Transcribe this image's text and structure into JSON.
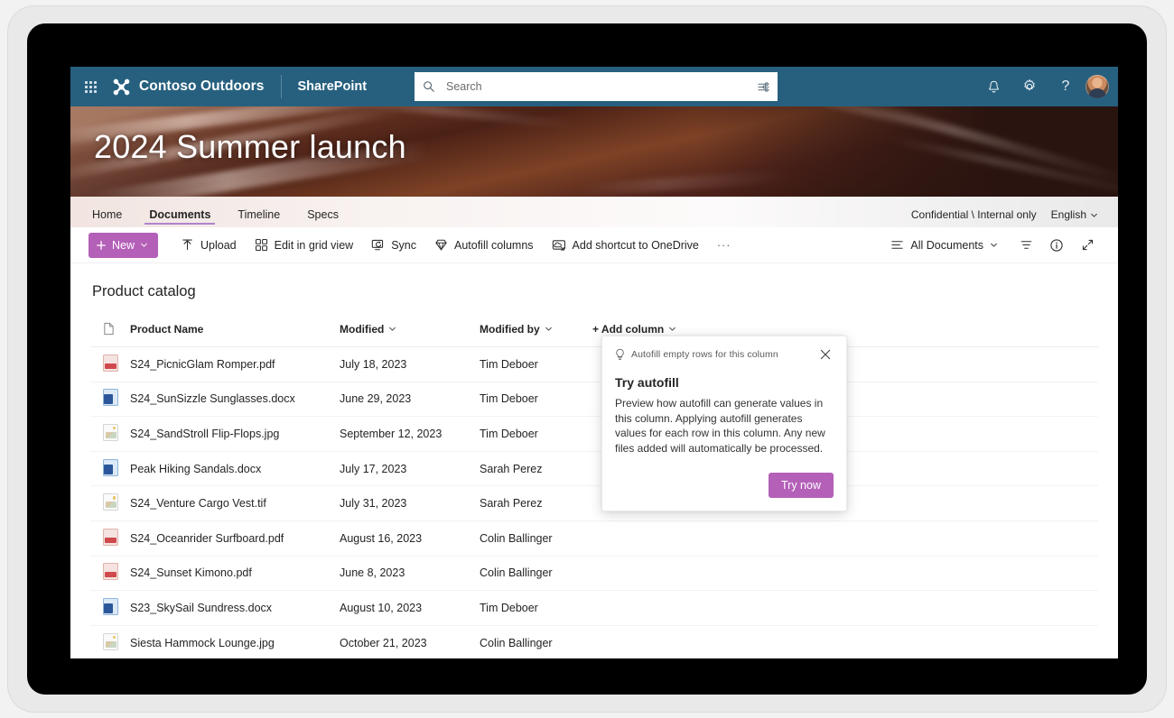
{
  "suite_header": {
    "waffle_label": "app-launcher",
    "brand_name": "Contoso Outdoors",
    "app_name": "SharePoint",
    "search_placeholder": "Search",
    "search_value": "",
    "icons": [
      "notifications-bell-icon",
      "settings-gear-icon",
      "help-question-icon",
      "user-avatar"
    ]
  },
  "hero": {
    "title": "2024 Summer launch"
  },
  "site_nav": {
    "items": [
      {
        "label": "Home",
        "active": false
      },
      {
        "label": "Documents",
        "active": true
      },
      {
        "label": "Timeline",
        "active": false
      },
      {
        "label": "Specs",
        "active": false
      }
    ],
    "sensitivity_label": "Confidential \\ Internal only",
    "language": "English"
  },
  "command_bar": {
    "new_label": "New",
    "commands": [
      {
        "label": "Upload",
        "icon": "upload-arrow-icon"
      },
      {
        "label": "Edit in grid view",
        "icon": "grid-view-icon"
      },
      {
        "label": "Sync",
        "icon": "sync-icon"
      },
      {
        "label": "Autofill columns",
        "icon": "autofill-diamond-icon"
      },
      {
        "label": "Add shortcut to OneDrive",
        "icon": "onedrive-shortcut-icon"
      }
    ],
    "overflow_label": "···",
    "view_label": "All Documents",
    "right_icons": [
      "filter-icon",
      "info-icon",
      "expand-icon"
    ]
  },
  "list": {
    "title": "Product catalog",
    "columns": [
      {
        "label": "",
        "icon": "document-type-icon",
        "sortable": false
      },
      {
        "label": "Product Name",
        "sortable": false
      },
      {
        "label": "Modified",
        "sortable": true
      },
      {
        "label": "Modified by",
        "sortable": true
      },
      {
        "label": "+ Add column",
        "sortable": true
      }
    ],
    "rows": [
      {
        "icon": "pdf-file-icon",
        "name": "S24_PicnicGlam Romper.pdf",
        "modified": "July 18, 2023",
        "modified_by": "Tim Deboer"
      },
      {
        "icon": "docx-file-icon",
        "name": "S24_SunSizzle Sunglasses.docx",
        "modified": "June 29, 2023",
        "modified_by": "Tim Deboer"
      },
      {
        "icon": "image-file-icon",
        "name": "S24_SandStroll Flip-Flops.jpg",
        "modified": "September 12, 2023",
        "modified_by": "Tim Deboer"
      },
      {
        "icon": "docx-file-icon",
        "name": "Peak Hiking Sandals.docx",
        "modified": "July 17, 2023",
        "modified_by": "Sarah Perez"
      },
      {
        "icon": "image-file-icon",
        "name": "S24_Venture Cargo Vest.tif",
        "modified": "July 31, 2023",
        "modified_by": "Sarah Perez"
      },
      {
        "icon": "pdf-file-icon",
        "name": "S24_Oceanrider Surfboard.pdf",
        "modified": "August 16, 2023",
        "modified_by": "Colin Ballinger"
      },
      {
        "icon": "pdf-file-icon",
        "name": "S24_Sunset Kimono.pdf",
        "modified": "June 8, 2023",
        "modified_by": "Colin Ballinger"
      },
      {
        "icon": "docx-file-icon",
        "name": "S23_SkySail Sundress.docx",
        "modified": "August 10, 2023",
        "modified_by": "Tim Deboer"
      },
      {
        "icon": "image-file-icon",
        "name": "Siesta Hammock Lounge.jpg",
        "modified": "October 21, 2023",
        "modified_by": "Colin Ballinger"
      }
    ]
  },
  "callout": {
    "hint": "Autofill empty rows for this column",
    "hint_icon": "lightbulb-icon",
    "close_icon": "close-icon",
    "heading": "Try autofill",
    "body": "Preview how autofill can generate values in this column. Applying autofill generates values for each row in this column. Any new files added will automatically be processed.",
    "primary_button": "Try now"
  },
  "colors": {
    "suite_header_bg": "#27607f",
    "accent_purple": "#b45fb8",
    "nav_active_underline": "#b084cc",
    "pdf_red": "#d0494c",
    "word_blue": "#2b579a"
  }
}
